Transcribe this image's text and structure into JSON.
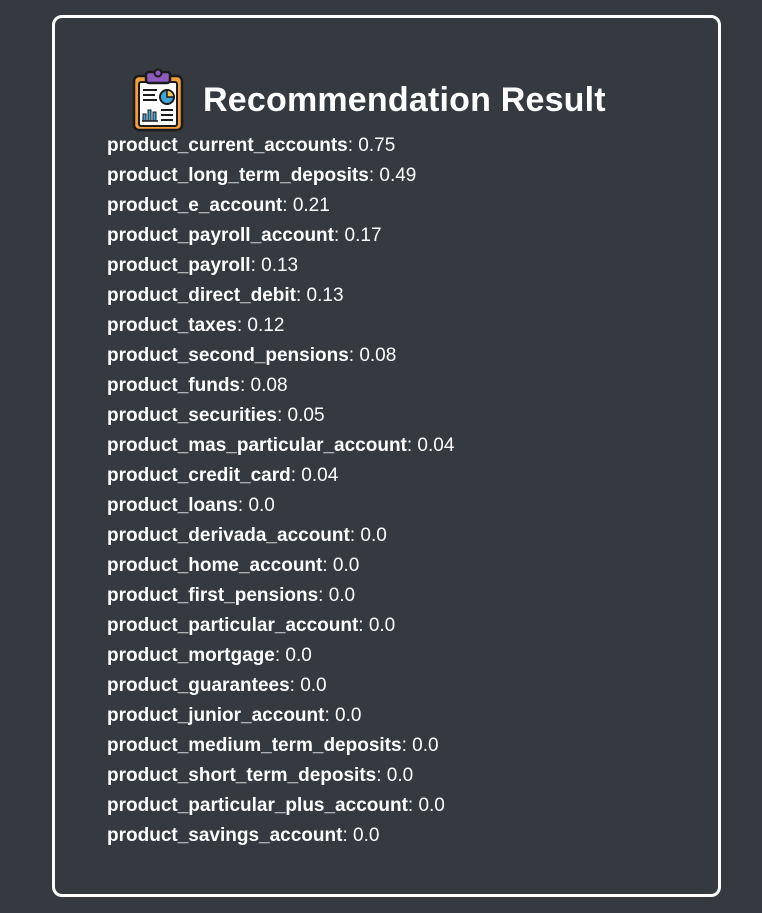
{
  "title": "Recommendation Result",
  "icon": "clipboard-report-icon",
  "colors": {
    "background": "#343a40",
    "border": "#ffffff",
    "text": "#ffffff"
  },
  "results": [
    {
      "name": "product_current_accounts",
      "value": ": 0.75"
    },
    {
      "name": "product_long_term_deposits",
      "value": ": 0.49"
    },
    {
      "name": "product_e_account",
      "value": ": 0.21"
    },
    {
      "name": "product_payroll_account",
      "value": ": 0.17"
    },
    {
      "name": "product_payroll",
      "value": ": 0.13"
    },
    {
      "name": "product_direct_debit",
      "value": ": 0.13"
    },
    {
      "name": "product_taxes",
      "value": ": 0.12"
    },
    {
      "name": "product_second_pensions",
      "value": ": 0.08"
    },
    {
      "name": "product_funds",
      "value": ": 0.08"
    },
    {
      "name": "product_securities",
      "value": ": 0.05"
    },
    {
      "name": "product_mas_particular_account",
      "value": ": 0.04"
    },
    {
      "name": "product_credit_card",
      "value": ": 0.04"
    },
    {
      "name": "product_loans",
      "value": ": 0.0"
    },
    {
      "name": "product_derivada_account",
      "value": ": 0.0"
    },
    {
      "name": "product_home_account",
      "value": ": 0.0"
    },
    {
      "name": "product_first_pensions",
      "value": ": 0.0"
    },
    {
      "name": "product_particular_account",
      "value": ": 0.0"
    },
    {
      "name": "product_mortgage",
      "value": ": 0.0"
    },
    {
      "name": "product_guarantees",
      "value": ": 0.0"
    },
    {
      "name": "product_junior_account",
      "value": ": 0.0"
    },
    {
      "name": "product_medium_term_deposits",
      "value": ": 0.0"
    },
    {
      "name": "product_short_term_deposits",
      "value": ": 0.0"
    },
    {
      "name": "product_particular_plus_account",
      "value": ": 0.0"
    },
    {
      "name": "product_savings_account",
      "value": ": 0.0"
    }
  ]
}
